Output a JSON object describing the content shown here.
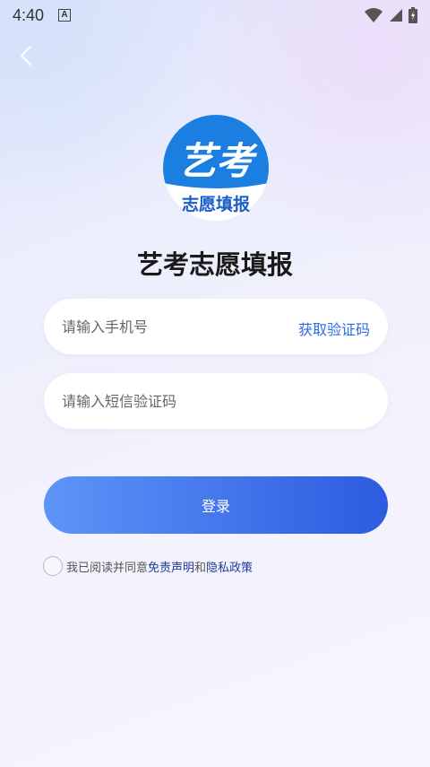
{
  "status_bar": {
    "time": "4:40",
    "notification_icon": "A"
  },
  "app": {
    "logo_text_top": "艺考",
    "logo_text_bottom": "志愿填报",
    "title": "艺考志愿填报"
  },
  "form": {
    "phone_placeholder": "请输入手机号",
    "get_code_label": "获取验证码",
    "code_placeholder": "请输入短信验证码",
    "login_label": "登录"
  },
  "agreement": {
    "prefix": "我已阅读并同意",
    "disclaimer_link": "免责声明",
    "connector": "和",
    "privacy_link": "隐私政策"
  },
  "colors": {
    "accent": "#2e6be6",
    "button_start": "#5d95f8",
    "button_end": "#2c5be0",
    "link": "#1f3a9c"
  }
}
